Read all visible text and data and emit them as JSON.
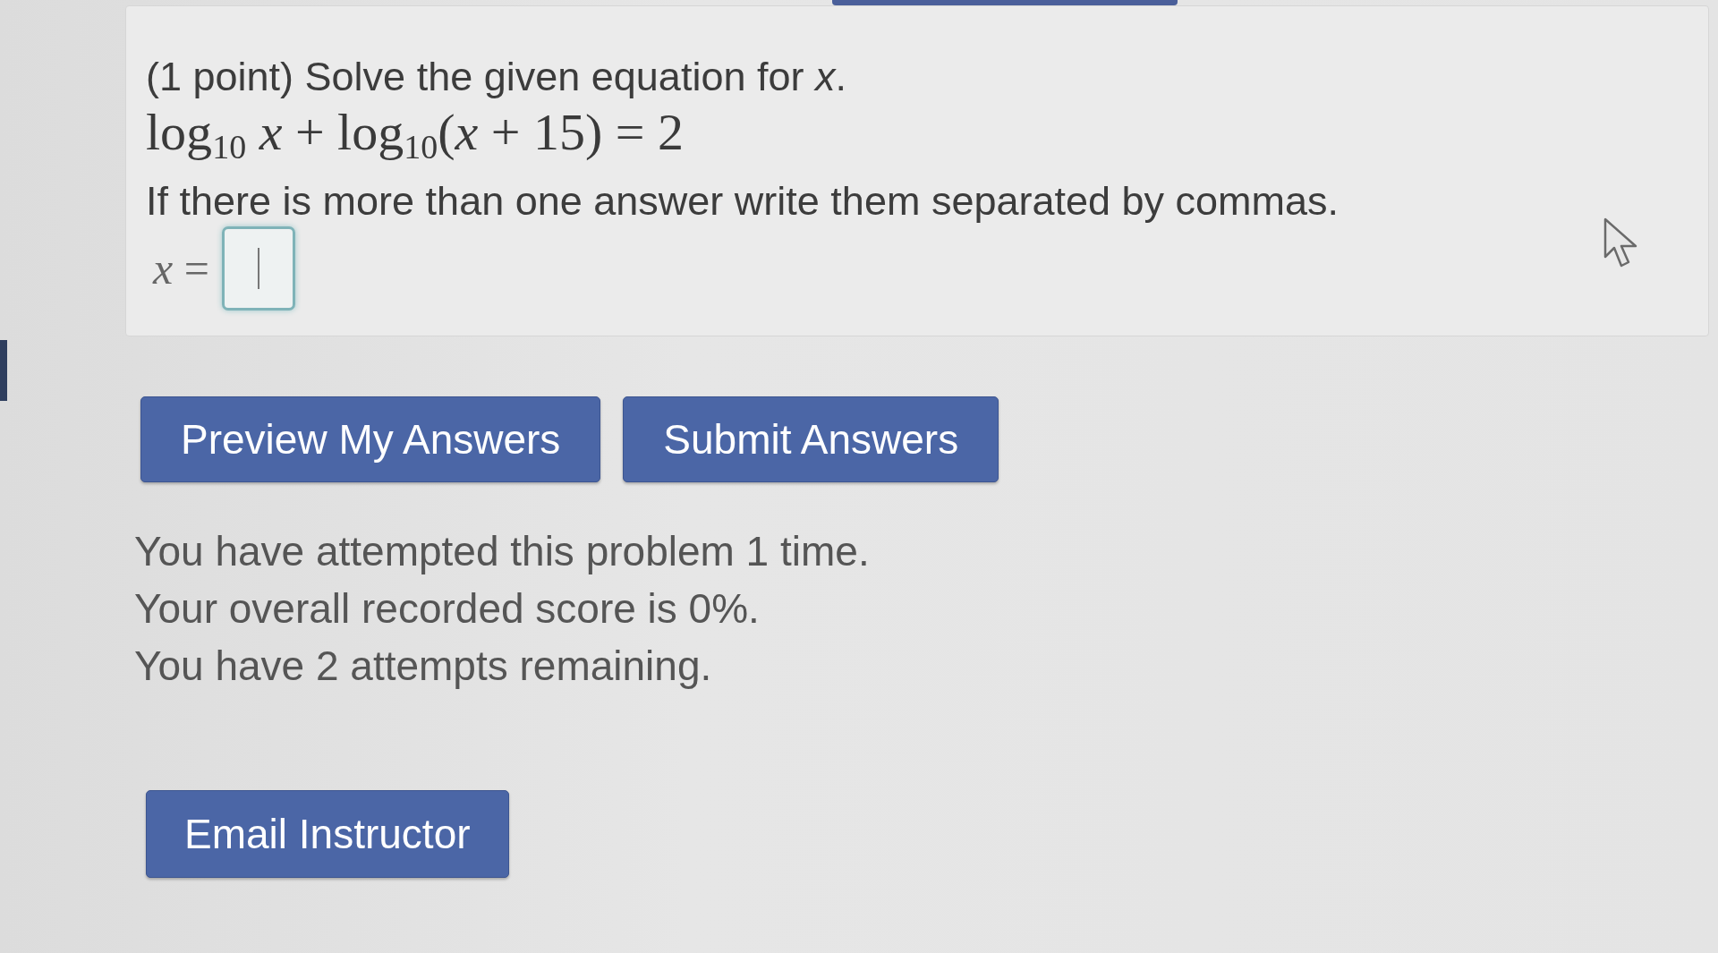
{
  "problem": {
    "statement": "(1 point) Solve the given equation for *x*.",
    "equation": "log$_{10}$ *x* + log$_{10}$(*x* + 15) = 2",
    "instruction": "If there is more than one answer write them separated by commas.",
    "answer": {
      "label": "*x* =",
      "focused": true
    }
  },
  "buttons": [
    {
      "label": "Preview My Answers"
    },
    {
      "label": "Submit Answers"
    }
  ],
  "status": [
    "You have attempted this problem 1 time.",
    "Your overall recorded score is 0%.",
    "You have 2 attempts remaining."
  ],
  "email_button": {
    "label": "Email Instructor"
  }
}
